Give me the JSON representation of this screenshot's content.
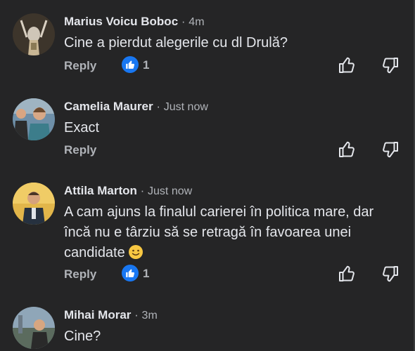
{
  "comments": [
    {
      "author": "Marius Voicu Boboc",
      "separator": "·",
      "time": "4m",
      "text": "Cine a pierdut alegerile cu dl Drulă?",
      "reply_label": "Reply",
      "like_count": "1"
    },
    {
      "author": "Camelia Maurer",
      "separator": "·",
      "time": "Just now",
      "text": "Exact",
      "reply_label": "Reply"
    },
    {
      "author": "Attila Marton",
      "separator": "·",
      "time": "Just now",
      "text": "A cam ajuns la finalul carierei în politica mare, dar încă nu e târziu să se retragă în favoarea unei candidate",
      "reply_label": "Reply",
      "like_count": "1",
      "emoji": "slightly-smiling-face-icon"
    },
    {
      "author": "Mihai Morar",
      "separator": "·",
      "time": "3m",
      "text": "Cine?"
    }
  ],
  "colors": {
    "background": "#252526",
    "text": "#e4e6eb",
    "muted": "#b0b3b8",
    "like_blue": "#1877f2"
  }
}
